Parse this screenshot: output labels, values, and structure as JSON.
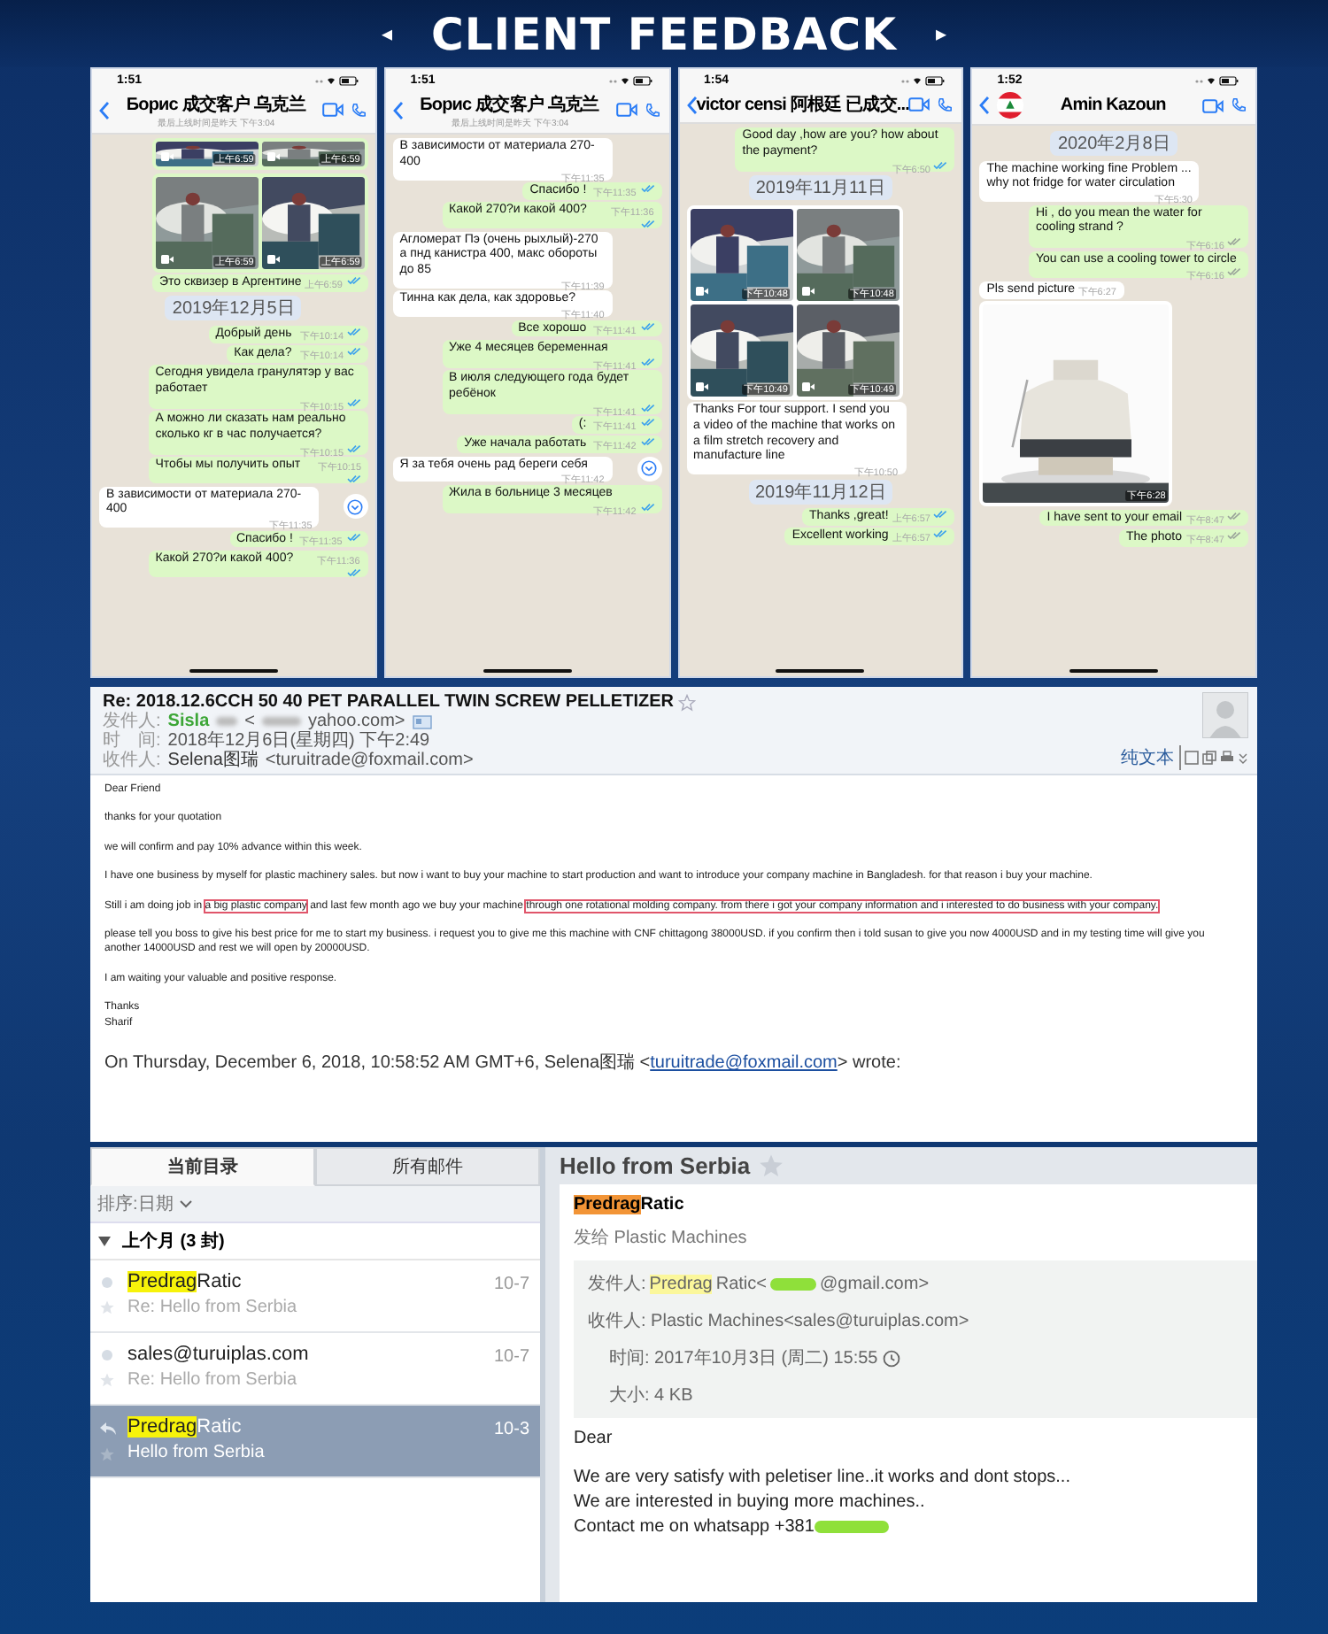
{
  "banner": {
    "left_mark": "◂",
    "title": "CLIENT FEEDBACK",
    "right_mark": "▸"
  },
  "chats": [
    {
      "status_time": "1:51",
      "contact": "Борис 成交客户 乌克兰",
      "last_seen": "最后上线时间是昨天 下午3:04",
      "messages": [
        {
          "kind": "out_photo_strip",
          "video": true,
          "times": [
            "上午6:59",
            "上午6:59"
          ]
        },
        {
          "kind": "out_photos",
          "video": true,
          "times": [
            "上午6:59",
            "上午6:59"
          ]
        },
        {
          "kind": "out",
          "text": "Это сквизер в Аргентине",
          "time": "上午6:59",
          "read": true
        },
        {
          "kind": "date",
          "text": "2019年12月5日"
        },
        {
          "kind": "out",
          "text": "Добрый день",
          "time": "下午10:14",
          "read": true
        },
        {
          "kind": "out",
          "text": "Как дела?",
          "time": "下午10:14",
          "read": true
        },
        {
          "kind": "out",
          "text": "Сегодня увидела гранулятэр у вас работает",
          "time": "下午10:15",
          "read": true
        },
        {
          "kind": "out",
          "text": "А можно ли сказать нам реально сколько кг в час получается?",
          "time": "下午10:15",
          "read": true
        },
        {
          "kind": "out",
          "text": "Чтобы мы получить опыт",
          "time": "下午10:15",
          "read": true
        },
        {
          "kind": "in",
          "text": "В зависимости от материала 270-400",
          "time": "下午11:35",
          "scroll_button": true
        },
        {
          "kind": "out",
          "text": "Спасибо !",
          "time": "下午11:35",
          "read": true
        },
        {
          "kind": "out",
          "text": "Какой 270?и какой 400?",
          "time": "下午11:36",
          "read": true
        }
      ]
    },
    {
      "status_time": "1:51",
      "contact": "Борис 成交客户 乌克兰",
      "last_seen": "最后上线时间是昨天 下午3:04",
      "messages": [
        {
          "kind": "in",
          "text": "В зависимости от материала 270-400",
          "time": "下午11:35"
        },
        {
          "kind": "out",
          "text": "Спасибо !",
          "time": "下午11:35",
          "read": true
        },
        {
          "kind": "out",
          "text": "Какой 270?и какой 400?",
          "time": "下午11:36",
          "read": true
        },
        {
          "kind": "in",
          "text": "Агломерат Пэ (очень рыхлый)-270 а пнд канистра 400, макс обороты до 85",
          "time": "下午11:39"
        },
        {
          "kind": "in",
          "text": "Тинна как дела, как здоровье?",
          "time": "下午11:40"
        },
        {
          "kind": "out",
          "text": "Все хорошо",
          "time": "下午11:41",
          "read": true
        },
        {
          "kind": "out",
          "text": "Уже 4 месяцев беременная",
          "time": "下午11:41",
          "read": true
        },
        {
          "kind": "out",
          "text": "В июля следующего года будет ребёнок",
          "time": "下午11:41",
          "read": true
        },
        {
          "kind": "out",
          "text": "(:",
          "time": "下午11:41",
          "read": true
        },
        {
          "kind": "out",
          "text": "Уже начала работать",
          "time": "下午11:42",
          "read": true
        },
        {
          "kind": "in",
          "text": "Я за тебя очень рад береги себя",
          "time": "下午11:42",
          "scroll_button": true
        },
        {
          "kind": "out",
          "text": "Жила в больнице 3 месяцев",
          "time": "下午11:42",
          "read": true
        }
      ]
    },
    {
      "status_time": "1:54",
      "contact": "victor censi 阿根廷 已成交...",
      "messages": [
        {
          "kind": "out",
          "text": "Good day ,how are you? how about the payment?",
          "time": "下午6:50",
          "read": true
        },
        {
          "kind": "date",
          "text": "2019年11月11日"
        },
        {
          "kind": "in_photos",
          "video": true,
          "times": [
            "下午10:48",
            "下午10:48",
            "下午10:49",
            "下午10:49"
          ]
        },
        {
          "kind": "in",
          "text": "Thanks For tour support. I send you a video of the machine that works on a film stretch recovery and manufacture line",
          "time": "下午10:50"
        },
        {
          "kind": "date",
          "text": "2019年11月12日"
        },
        {
          "kind": "out",
          "text": "Thanks ,great!",
          "time": "上午6:57",
          "read": true
        },
        {
          "kind": "out",
          "text": "Excellent working",
          "time": "上午6:57",
          "read": true
        }
      ]
    },
    {
      "status_time": "1:52",
      "contact": "Amin Kazoun",
      "avatar": true,
      "messages": [
        {
          "kind": "date",
          "text": "2020年2月8日"
        },
        {
          "kind": "in",
          "text": "The machine working fine Problem ... why not fridge for water circulation",
          "time": "下午5:30"
        },
        {
          "kind": "out",
          "text": "Hi , do you mean the water for cooling strand ?",
          "time": "下午6:16",
          "read": false
        },
        {
          "kind": "out",
          "text": "You can use a cooling tower to circle",
          "time": "下午6:16",
          "read": false
        },
        {
          "kind": "in",
          "text": "Pls send picture",
          "time": "下午6:27"
        },
        {
          "kind": "in_photos",
          "times": [
            "下午6:28"
          ]
        },
        {
          "kind": "out",
          "text": "I have sent to your email",
          "time": "下午8:47",
          "read": false
        },
        {
          "kind": "out",
          "text": "The photo",
          "time": "下午8:47",
          "read": false
        }
      ]
    }
  ],
  "email": {
    "subject": "Re: 2018.12.6CCH 50 40 PET PARALLEL TWIN SCREW PELLETIZER",
    "from_label": "发件人:",
    "from_name": "Sisla",
    "from_open": "<",
    "from_domain": "yahoo.com>",
    "time_label": "时　间:",
    "time": "2018年12月6日(星期四) 下午2:49",
    "to_label": "收件人:",
    "to_name": "Selena图瑞",
    "to_address": "<turuitrade@foxmail.com>",
    "plain_text": "纯文本",
    "paragraphs": [
      [
        {
          "text": "Dear Friend",
          "boxed": false
        }
      ],
      [
        {
          "text": "thanks for your quotation",
          "boxed": false
        }
      ],
      [
        {
          "text": "we will confirm and pay 10% advance within this week.",
          "boxed": false
        }
      ],
      [
        {
          "text": "I have one business by myself for plastic machinery sales. but now i want to buy your machine to start production and want to introduce your company machine in Bangladesh. for that reason i buy your machine.",
          "boxed": false
        }
      ],
      [
        {
          "text": "Still i am doing job in ",
          "boxed": false
        },
        {
          "text": "a big plastic company",
          "boxed": true
        },
        {
          "text": " and last few month ago we buy your machine ",
          "boxed": false
        },
        {
          "text": "through one rotational molding company. from there i got your company information and i interested to do business with your company.",
          "boxed": true
        }
      ],
      [
        {
          "text": "please tell you boss to give his best price for me to start my business. i request you to give me this machine with CNF chittagong 38000USD. if you confirm then i told susan to give you now 4000USD and in my testing time will give you another 14000USD and rest we will open by 20000USD.",
          "boxed": false
        }
      ],
      [
        {
          "text": "I am waiting your valuable and positive response.",
          "boxed": false
        }
      ]
    ],
    "signature": [
      "Thanks",
      "Sharif"
    ],
    "quote": {
      "text": "On Thursday, December 6, 2018, 10:58:52 AM GMT+6, Selena图瑞 <",
      "link": "turuitrade@foxmail.com",
      "after": "> wrote:"
    }
  },
  "mail_client": {
    "tabs": [
      {
        "label": "当前目录",
        "selected": true
      },
      {
        "label": "所有邮件",
        "selected": false
      }
    ],
    "sort": "排序:日期",
    "group": {
      "label": "上个月 (3 封)",
      "expanded": true
    },
    "items": [
      {
        "sender_match": "Predrag",
        "sender_rest": " Ratic",
        "subject": "Re: Hello from Serbia",
        "date": "10-7",
        "selected": false,
        "replied": false
      },
      {
        "sender_rest": "sales@turuiplas.com",
        "subject": "Re: Hello from Serbia",
        "date": "10-7",
        "selected": false,
        "replied": false
      },
      {
        "sender_match": "Predrag",
        "sender_rest": " Ratic",
        "subject": "Hello from Serbia",
        "date": "10-3",
        "selected": true,
        "replied": true
      }
    ],
    "message": {
      "title": "Hello from Serbia",
      "sender_match": "Predrag",
      "sender_rest": " Ratic",
      "sent_to": "发给 Plastic Machines",
      "from_label": "发件人:",
      "from_match": "Predrag",
      "from_rest": " Ratic<",
      "from_domain": "@gmail.com>",
      "to": "收件人: Plastic Machines<sales@turuiplas.com>",
      "time": "时间: 2017年10月3日 (周二) 15:55",
      "size": "大小: 4 KB",
      "body": [
        "Dear",
        "We are very satisfy with peletiser line..it works and dont stops...",
        "We are interested in buying more machines..",
        "Contact me on whatsapp +381"
      ]
    }
  }
}
